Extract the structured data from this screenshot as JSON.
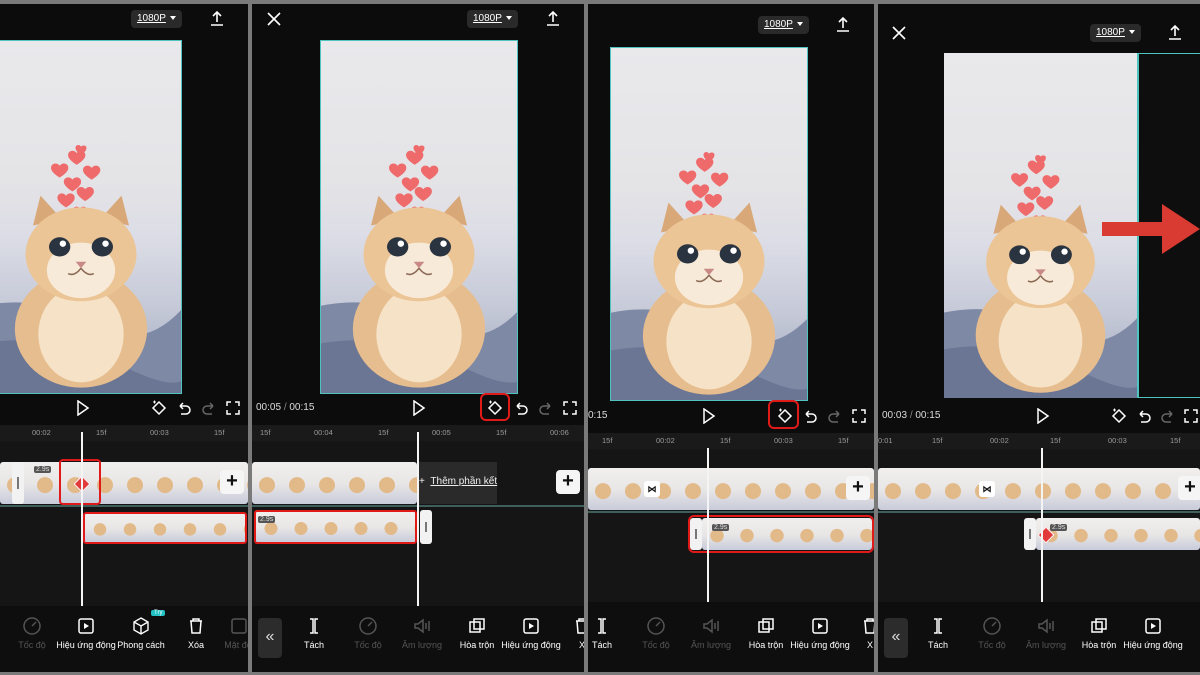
{
  "panel1": {
    "resolution": "1080P",
    "ruler_labels": [
      "00:02",
      "15f",
      "00:03",
      "15f"
    ],
    "clip_badge": "2.9s",
    "tools": [
      {
        "label": "Tốc độ",
        "icon": "speed-icon"
      },
      {
        "label": "Hiệu ứng động",
        "icon": "animation-icon"
      },
      {
        "label": "Phong cách",
        "icon": "style-icon"
      },
      {
        "label": "Xóa",
        "icon": "delete-icon"
      },
      {
        "label": "Mặt đổi",
        "icon": "face-icon"
      }
    ],
    "try_badge": "Try"
  },
  "panel2": {
    "resolution": "1080P",
    "time_current": "00:05",
    "time_sep": "/",
    "time_total": "00:15",
    "ruler_labels": [
      "15f",
      "00:04",
      "15f",
      "00:05",
      "15f",
      "00:06"
    ],
    "add_end_label": "Thêm phần kết",
    "clip_badge": "2.9s",
    "back_label": "«",
    "tools": [
      {
        "label": "Tách",
        "icon": "split-icon"
      },
      {
        "label": "Tốc độ",
        "icon": "speed-icon"
      },
      {
        "label": "Âm lượng",
        "icon": "volume-icon"
      },
      {
        "label": "Hòa trộn",
        "icon": "blend-icon"
      },
      {
        "label": "Hiệu ứng động",
        "icon": "animation-icon"
      },
      {
        "label": "X",
        "icon": "delete-icon"
      }
    ]
  },
  "panel3": {
    "resolution": "1080P",
    "time_fragment": "0:15",
    "ruler_labels": [
      "15f",
      "00:02",
      "15f",
      "00:03",
      "15f"
    ],
    "clip_badge": "2.9s",
    "tools": [
      {
        "label": "Tách",
        "icon": "split-icon"
      },
      {
        "label": "Tốc độ",
        "icon": "speed-icon"
      },
      {
        "label": "Âm lượng",
        "icon": "volume-icon"
      },
      {
        "label": "Hòa trộn",
        "icon": "blend-icon"
      },
      {
        "label": "Hiệu ứng động",
        "icon": "animation-icon"
      },
      {
        "label": "X",
        "icon": "delete-icon"
      }
    ]
  },
  "panel4": {
    "resolution": "1080P",
    "time_current": "00:03",
    "time_sep": "/",
    "time_total": "00:15",
    "ruler_labels": [
      "0:01",
      "15f",
      "00:02",
      "15f",
      "00:03",
      "15f"
    ],
    "clip_badge": "2.9s",
    "back_label": "«",
    "tools": [
      {
        "label": "Tách",
        "icon": "split-icon"
      },
      {
        "label": "Tốc độ",
        "icon": "speed-icon"
      },
      {
        "label": "Âm lượng",
        "icon": "volume-icon"
      },
      {
        "label": "Hòa trộn",
        "icon": "blend-icon"
      },
      {
        "label": "Hiệu ứng động",
        "icon": "animation-icon"
      }
    ]
  },
  "colors": {
    "highlight_red": "#e01919",
    "preview_border": "#4fc3c0",
    "background": "#0c0c0c",
    "arrow_red": "#d93a32"
  }
}
